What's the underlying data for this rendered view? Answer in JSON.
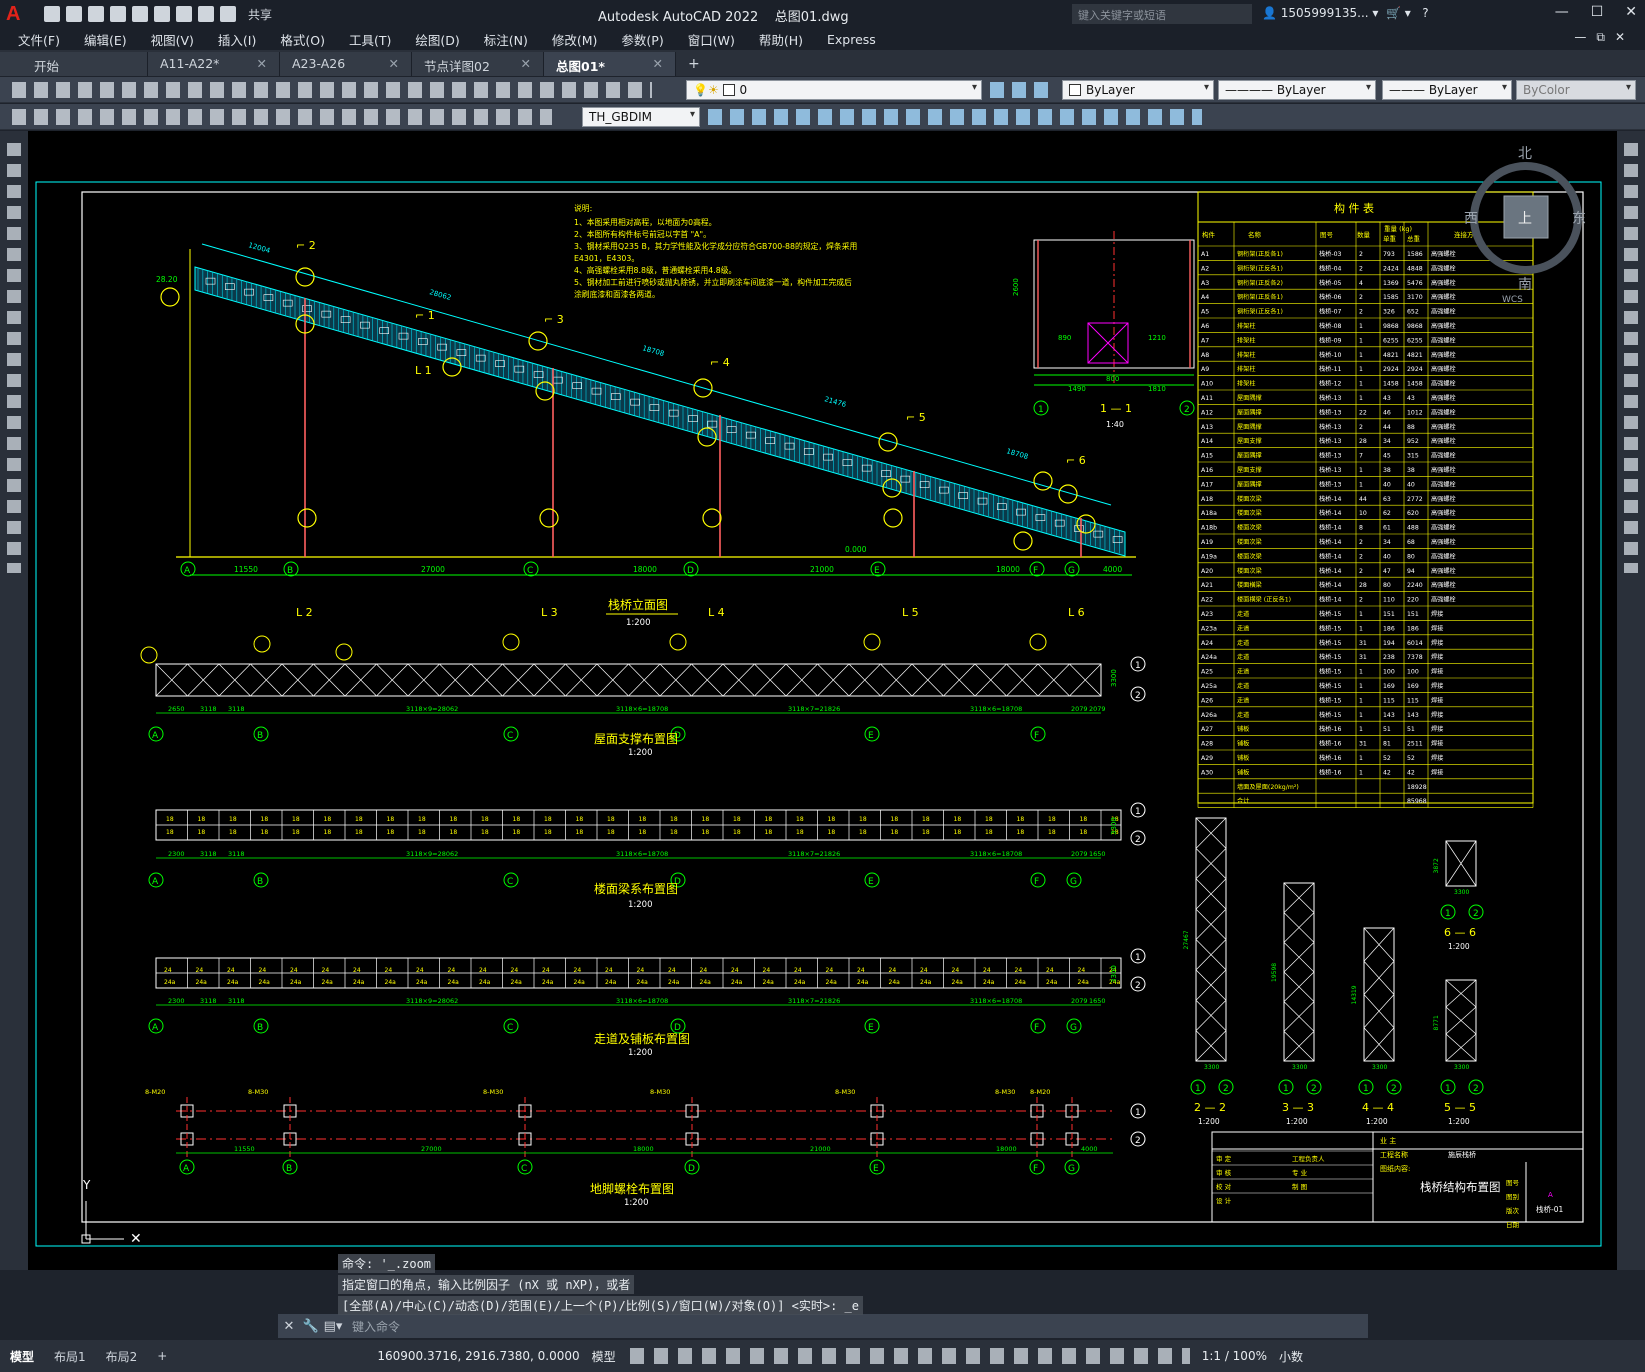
{
  "titlebar": {
    "app_title": "Autodesk AutoCAD 2022",
    "file_name": "总图01.dwg",
    "share_label": "共享",
    "search_placeholder": "键入关键字或短语",
    "user": "1505999135...",
    "help": "?"
  },
  "menu": [
    "文件(F)",
    "编辑(E)",
    "视图(V)",
    "插入(I)",
    "格式(O)",
    "工具(T)",
    "绘图(D)",
    "标注(N)",
    "修改(M)",
    "参数(P)",
    "窗口(W)",
    "帮助(H)",
    "Express"
  ],
  "file_tabs": [
    {
      "label": "开始",
      "closable": false,
      "active": false
    },
    {
      "label": "A11-A22*",
      "closable": true,
      "active": false
    },
    {
      "label": "A23-A26",
      "closable": true,
      "active": false
    },
    {
      "label": "节点详图02",
      "closable": true,
      "active": false
    },
    {
      "label": "总图01*",
      "closable": true,
      "active": true
    }
  ],
  "toolbar": {
    "layer_value": "0",
    "color_value": "ByLayer",
    "linetype_value": "ByLayer",
    "lineweight_value": "ByLayer",
    "plotstyle_value": "ByColor",
    "dimstyle_value": "TH_GBDIM"
  },
  "viewcube": {
    "north": "北",
    "south": "南",
    "east": "东",
    "west": "西",
    "top": "上",
    "wcs": "WCS"
  },
  "drawing": {
    "elevation_title": "栈桥立面图",
    "elevation_scale": "1:200",
    "roof_title": "屋面支撑布置图",
    "roof_scale": "1:200",
    "floor_title": "楼面梁系布置图",
    "floor_scale": "1:200",
    "walk_title": "走道及铺板布置图",
    "walk_scale": "1:200",
    "bolt_title": "地脚螺栓布置图",
    "bolt_scale": "1:200",
    "section11_title": "1 — 1",
    "section11_scale": "1:40",
    "notes_title": "说明:",
    "notes": [
      "1、本图采用相对高程，以地面为0高程。",
      "2、本图所有构件标号前冠以字首 \"A\"。",
      "3、钢材采用Q235 B，其力学性能及化学成分应符合GB700-88的规定，焊条采用",
      "   E4301，E4303。",
      "4、高强螺栓采用8.8级，普通螺栓采用4.8级。",
      "5、钢材加工前进行喷砂或抛丸除锈，并立即刷涂车间底漆一道，构件加工完成后",
      "   涂刷底漆和面漆各两道。"
    ],
    "axis_labels": [
      "A",
      "B",
      "C",
      "D",
      "E",
      "F",
      "G"
    ],
    "span_dims": [
      "11550",
      "27000",
      "18000",
      "21000",
      "18000",
      "4000"
    ],
    "truss_dims": [
      "28062",
      "18708",
      "21476",
      "18708",
      "12004"
    ],
    "elev_marks": [
      "28.20",
      "0.000"
    ],
    "sec11_dims": [
      "2600",
      "890",
      "1210",
      "800",
      "1490",
      "1810"
    ],
    "roof_dims": [
      "2650",
      "3118",
      "3118",
      "3118×9=28062",
      "3118×6=18708",
      "3118×7=21826",
      "3118×6=18708",
      "2079",
      "2079",
      "3300"
    ],
    "floor_dims": [
      "2300",
      "3118",
      "3118",
      "3118×9=28062",
      "3118×6=18708",
      "3118×7=21826",
      "3118×6=18708",
      "2079",
      "1650",
      "3300"
    ],
    "bolt_labels": [
      "8-M20",
      "8-M30",
      "8-M30",
      "8-M30",
      "8-M30",
      "8-M30",
      "8-M20"
    ],
    "small_sections": [
      {
        "title": "2 — 2",
        "scale": "1:200",
        "height": "27467",
        "width": "3300"
      },
      {
        "title": "3 — 3",
        "scale": "1:200",
        "height": "19598",
        "width": "3300"
      },
      {
        "title": "4 — 4",
        "scale": "1:200",
        "height": "14319",
        "width": "3300"
      },
      {
        "title": "5 — 5",
        "scale": "1:200",
        "height": "8771",
        "width": "3300"
      },
      {
        "title": "6 — 6",
        "scale": "1:200",
        "height": "3872",
        "width": "3300"
      }
    ],
    "member_table": {
      "title": "构 件 表",
      "headers": [
        "构件",
        "名称",
        "图号",
        "数量",
        "单重",
        "总重",
        "连接方法"
      ],
      "weight_header": "重量 (kg)",
      "rows": [
        [
          "A1",
          "钢桁架(正反各1)",
          "栈桥-03",
          "2",
          "793",
          "1586",
          "高强螺栓"
        ],
        [
          "A2",
          "钢桁架(正反各1)",
          "栈桥-04",
          "2",
          "2424",
          "4848",
          "高强螺栓"
        ],
        [
          "A3",
          "钢桁架(正反各2)",
          "栈桥-05",
          "4",
          "1369",
          "5476",
          "高强螺栓"
        ],
        [
          "A4",
          "钢桁架(正反各1)",
          "栈桥-06",
          "2",
          "1585",
          "3170",
          "高强螺栓"
        ],
        [
          "A5",
          "钢桁架(正反各1)",
          "栈桥-07",
          "2",
          "326",
          "652",
          "高强螺栓"
        ],
        [
          "A6",
          "排架柱",
          "栈桥-08",
          "1",
          "9868",
          "9868",
          "高强螺栓"
        ],
        [
          "A7",
          "排架柱",
          "栈桥-09",
          "1",
          "6255",
          "6255",
          "高强螺栓"
        ],
        [
          "A8",
          "排架柱",
          "栈桥-10",
          "1",
          "4821",
          "4821",
          "高强螺栓"
        ],
        [
          "A9",
          "排架柱",
          "栈桥-11",
          "1",
          "2924",
          "2924",
          "高强螺栓"
        ],
        [
          "A10",
          "排架柱",
          "栈桥-12",
          "1",
          "1458",
          "1458",
          "高强螺栓"
        ],
        [
          "A11",
          "屋面隅撑",
          "栈桥-13",
          "1",
          "43",
          "43",
          "高强螺栓"
        ],
        [
          "A12",
          "屋面隅撑",
          "栈桥-13",
          "22",
          "46",
          "1012",
          "高强螺栓"
        ],
        [
          "A13",
          "屋面隅撑",
          "栈桥-13",
          "2",
          "44",
          "88",
          "高强螺栓"
        ],
        [
          "A14",
          "屋面支撑",
          "栈桥-13",
          "28",
          "34",
          "952",
          "高强螺栓"
        ],
        [
          "A15",
          "屋面隅撑",
          "栈桥-13",
          "7",
          "45",
          "315",
          "高强螺栓"
        ],
        [
          "A16",
          "屋面支撑",
          "栈桥-13",
          "1",
          "38",
          "38",
          "高强螺栓"
        ],
        [
          "A17",
          "屋面隅撑",
          "栈桥-13",
          "1",
          "40",
          "40",
          "高强螺栓"
        ],
        [
          "A18",
          "楼面次梁",
          "栈桥-14",
          "44",
          "63",
          "2772",
          "高强螺栓"
        ],
        [
          "A18a",
          "楼面次梁",
          "栈桥-14",
          "10",
          "62",
          "620",
          "高强螺栓"
        ],
        [
          "A18b",
          "楼面次梁",
          "栈桥-14",
          "8",
          "61",
          "488",
          "高强螺栓"
        ],
        [
          "A19",
          "楼面次梁",
          "栈桥-14",
          "2",
          "34",
          "68",
          "高强螺栓"
        ],
        [
          "A19a",
          "楼面次梁",
          "栈桥-14",
          "2",
          "40",
          "80",
          "高强螺栓"
        ],
        [
          "A20",
          "楼面次梁",
          "栈桥-14",
          "2",
          "47",
          "94",
          "高强螺栓"
        ],
        [
          "A21",
          "楼面横梁",
          "栈桥-14",
          "28",
          "80",
          "2240",
          "高强螺栓"
        ],
        [
          "A22",
          "楼面横梁 (正反各1)",
          "栈桥-14",
          "2",
          "110",
          "220",
          "高强螺栓"
        ],
        [
          "A23",
          "走道",
          "栈桥-15",
          "1",
          "151",
          "151",
          "焊接"
        ],
        [
          "A23a",
          "走道",
          "栈桥-15",
          "1",
          "186",
          "186",
          "焊接"
        ],
        [
          "A24",
          "走道",
          "栈桥-15",
          "31",
          "194",
          "6014",
          "焊接"
        ],
        [
          "A24a",
          "走道",
          "栈桥-15",
          "31",
          "238",
          "7378",
          "焊接"
        ],
        [
          "A25",
          "走道",
          "栈桥-15",
          "1",
          "100",
          "100",
          "焊接"
        ],
        [
          "A25a",
          "走道",
          "栈桥-15",
          "1",
          "169",
          "169",
          "焊接"
        ],
        [
          "A26",
          "走道",
          "栈桥-15",
          "1",
          "115",
          "115",
          "焊接"
        ],
        [
          "A26a",
          "走道",
          "栈桥-15",
          "1",
          "143",
          "143",
          "焊接"
        ],
        [
          "A27",
          "铺板",
          "栈桥-16",
          "1",
          "51",
          "51",
          "焊接"
        ],
        [
          "A28",
          "铺板",
          "栈桥-16",
          "31",
          "81",
          "2511",
          "焊接"
        ],
        [
          "A29",
          "铺板",
          "栈桥-16",
          "1",
          "52",
          "52",
          "焊接"
        ],
        [
          "A30",
          "铺板",
          "栈桥-16",
          "1",
          "42",
          "42",
          "焊接"
        ]
      ],
      "extra_row_label": "墙面及屋面(20kg/m²)",
      "extra_row_value": "18928",
      "total_label": "合计",
      "total_value": "85968"
    },
    "title_block": {
      "drawing_name": "栈桥结构布置图",
      "owner_label": "业 主",
      "project_label": "工程名称",
      "project_value": "施辰栈桥",
      "drawing_content_label": "图纸内容:",
      "roles": [
        "审 定",
        "审 核",
        "校 对",
        "设 计",
        "工程负责人",
        "专 业",
        "制 图"
      ],
      "code_labels": [
        "图号",
        "图别",
        "版次",
        "日期"
      ],
      "sheet_no": "栈桥-01",
      "grade": "A"
    }
  },
  "command_history": [
    "命令: '_.zoom",
    "指定窗口的角点，输入比例因子 (nX 或 nXP)，或者",
    "[全部(A)/中心(C)/动态(D)/范围(E)/上一个(P)/比例(S)/窗口(W)/对象(O)] <实时>: _e"
  ],
  "command_input_placeholder": "键入命令",
  "status": {
    "layout_tabs": [
      "模型",
      "布局1",
      "布局2"
    ],
    "coords": "160900.3716, 2916.7380, 0.0000",
    "model_label": "模型",
    "scale": "1:1 / 100%",
    "units": "小数"
  },
  "colors": {
    "cyan": "#00ffff",
    "yellow": "#ffff00",
    "green": "#00ff00",
    "red": "#ff3030",
    "white": "#ffffff",
    "magenta": "#ff00ff"
  }
}
